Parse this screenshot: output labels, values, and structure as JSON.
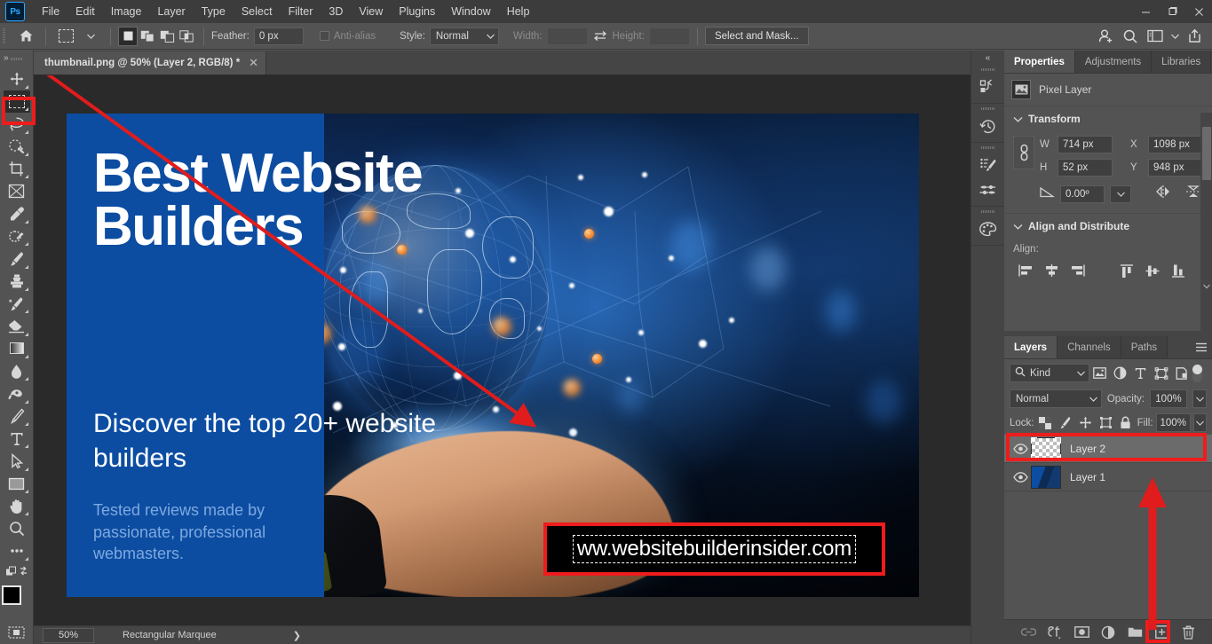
{
  "app": {
    "logo": "Ps",
    "menus": [
      "File",
      "Edit",
      "Image",
      "Layer",
      "Type",
      "Select",
      "Filter",
      "3D",
      "View",
      "Plugins",
      "Window",
      "Help"
    ]
  },
  "window_controls": {
    "minimize": "minimize-icon",
    "maximize": "restore-icon",
    "close": "close-icon"
  },
  "options_bar": {
    "home_icon": "home-icon",
    "tool_preset": "rectangular-marquee-icon",
    "selection_modes": [
      "new-selection",
      "add-to-selection",
      "subtract-from-selection",
      "intersect-with-selection"
    ],
    "feather_label": "Feather:",
    "feather_value": "0 px",
    "antialias_label": "Anti-alias",
    "antialias_checked": false,
    "style_label": "Style:",
    "style_value": "Normal",
    "width_label": "Width:",
    "width_value": "",
    "swap_icon": "swap-width-height-icon",
    "height_label": "Height:",
    "height_value": "",
    "select_and_mask": "Select and Mask...",
    "right_icons": [
      "share-user-icon",
      "search-icon",
      "workspace-icon",
      "chevron-down-icon",
      "export-icon"
    ]
  },
  "toolbar": {
    "tools": [
      {
        "name": "move-tool",
        "selected": false
      },
      {
        "name": "rectangular-marquee-tool",
        "selected": true
      },
      {
        "name": "lasso-tool",
        "selected": false
      },
      {
        "name": "object-selection-tool",
        "selected": false
      },
      {
        "name": "crop-tool",
        "selected": false
      },
      {
        "name": "frame-tool",
        "selected": false
      },
      {
        "name": "eyedropper-tool",
        "selected": false
      },
      {
        "name": "spot-healing-brush-tool",
        "selected": false
      },
      {
        "name": "brush-tool",
        "selected": false
      },
      {
        "name": "clone-stamp-tool",
        "selected": false
      },
      {
        "name": "history-brush-tool",
        "selected": false
      },
      {
        "name": "eraser-tool",
        "selected": false
      },
      {
        "name": "gradient-tool",
        "selected": false
      },
      {
        "name": "blur-tool",
        "selected": false
      },
      {
        "name": "dodge-tool",
        "selected": false
      },
      {
        "name": "pen-tool",
        "selected": false
      },
      {
        "name": "type-tool",
        "selected": false
      },
      {
        "name": "path-selection-tool",
        "selected": false
      },
      {
        "name": "rectangle-tool",
        "selected": false
      },
      {
        "name": "hand-tool",
        "selected": false
      },
      {
        "name": "zoom-tool",
        "selected": false
      },
      {
        "name": "edit-toolbar-tool",
        "selected": false
      }
    ],
    "quick_mask_icon": "quick-mask-icon",
    "foreground_color": "#000000",
    "background_color": "#b9a7e6"
  },
  "document": {
    "tab_title": "thumbnail.png @ 50% (Layer 2, RGB/8) *",
    "close_icon": "close-icon"
  },
  "artwork": {
    "headline": "Best Website Builders",
    "subhead": "Discover the top 20+ website builders",
    "tertiary": "Tested reviews made by passionate, professional webmasters.",
    "url_text": "ww.websitebuilderinsider.com",
    "panel_color": "#0c4da2",
    "tertiary_color": "#7ea9de",
    "annotation_color": "#ee1c1c"
  },
  "right_rail": {
    "collapse_icon": "double-chevron-left-icon",
    "icons": [
      "actions-icon",
      "history-icon",
      "brush-settings-icon",
      "adjustments-presets-icon",
      "swatches-icon"
    ]
  },
  "properties_panel": {
    "tabs": [
      {
        "label": "Properties",
        "active": true
      },
      {
        "label": "Adjustments",
        "active": false
      },
      {
        "label": "Libraries",
        "active": false
      }
    ],
    "menu_icon": "panel-menu-icon",
    "layer_type_icon": "pixel-layer-icon",
    "layer_type": "Pixel Layer",
    "transform": {
      "title": "Transform",
      "collapse_icon": "chevron-down-icon",
      "link_icon": "link-constrain-icon",
      "w_label": "W",
      "w_value": "714 px",
      "x_label": "X",
      "x_value": "1098 px",
      "h_label": "H",
      "h_value": "52 px",
      "y_label": "Y",
      "y_value": "948 px",
      "angle_icon": "angle-icon",
      "angle_value": "0.00º",
      "flip_horizontal_icon": "flip-horizontal-icon",
      "flip_vertical_icon": "flip-vertical-icon"
    },
    "align": {
      "title": "Align and Distribute",
      "collapse_icon": "chevron-down-icon",
      "label": "Align:",
      "icons": [
        "align-left-edges-icon",
        "align-horizontal-centers-icon",
        "align-right-edges-icon",
        "align-top-edges-icon",
        "align-vertical-centers-icon",
        "align-bottom-edges-icon"
      ]
    }
  },
  "layers_panel": {
    "tabs": [
      {
        "label": "Layers",
        "active": true
      },
      {
        "label": "Channels",
        "active": false
      },
      {
        "label": "Paths",
        "active": false
      }
    ],
    "menu_icon": "panel-menu-icon",
    "filter": {
      "search_icon": "search-icon",
      "kind_label": "Kind",
      "chevron_icon": "chevron-down-icon",
      "type_icons": [
        "pixel-filter-icon",
        "adjustment-filter-icon",
        "type-filter-icon",
        "shape-filter-icon",
        "smart-object-filter-icon"
      ],
      "toggle_icon": "filter-toggle-switch"
    },
    "blend_mode": "Normal",
    "opacity_label": "Opacity:",
    "opacity_value": "100%",
    "lock_label": "Lock:",
    "lock_icons": [
      "lock-transparent-pixels-icon",
      "lock-image-pixels-icon",
      "lock-position-icon",
      "lock-artboard-nesting-icon",
      "lock-all-icon"
    ],
    "fill_label": "Fill:",
    "fill_value": "100%",
    "layers": [
      {
        "name": "Layer 2",
        "visible": true,
        "selected": true,
        "thumb": "transparent"
      },
      {
        "name": "Layer 1",
        "visible": true,
        "selected": false,
        "thumb": "image"
      }
    ],
    "footer_icons": [
      "link-layers-icon",
      "layer-style-fx-icon",
      "add-layer-mask-icon",
      "new-adjustment-layer-icon",
      "new-group-icon",
      "new-layer-icon",
      "delete-layer-icon"
    ]
  },
  "status_bar": {
    "zoom": "50%",
    "tool_name": "Rectangular Marquee",
    "chevron_icon": "chevron-right-icon"
  }
}
